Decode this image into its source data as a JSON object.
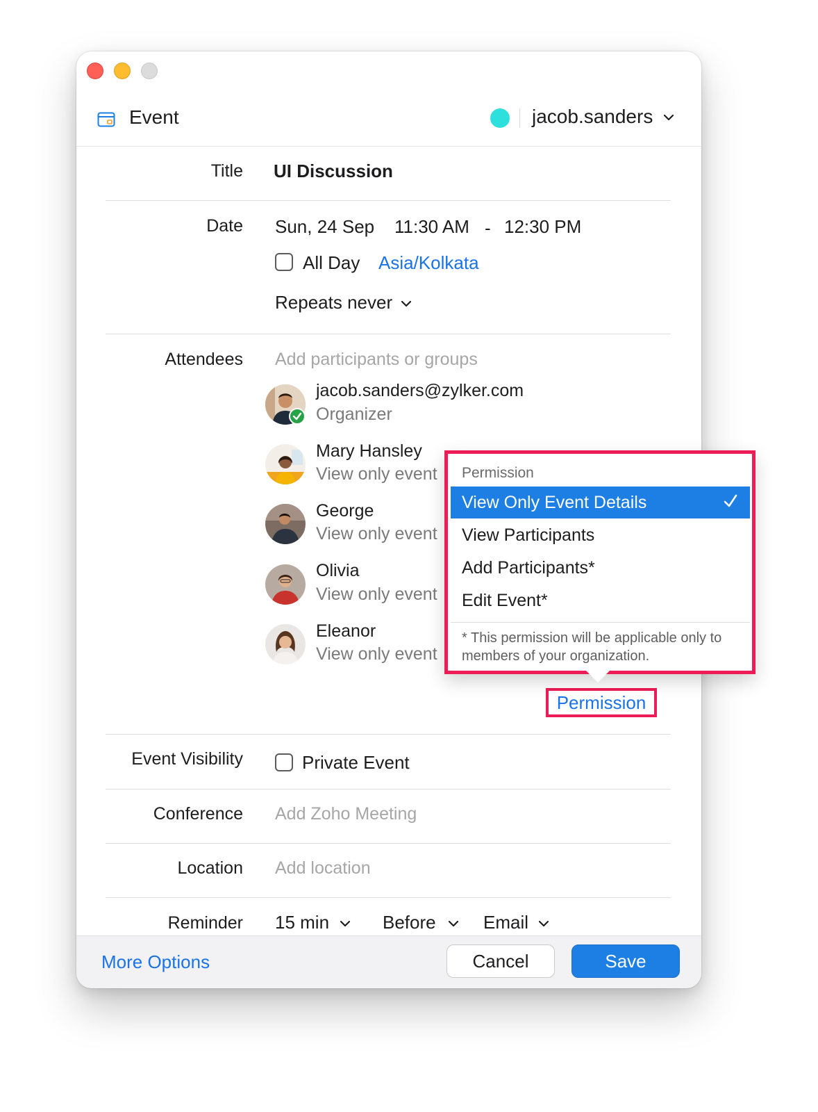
{
  "header": {
    "title": "Event",
    "account": "jacob.sanders",
    "account_color": "#2ee0dd"
  },
  "title_row": {
    "label": "Title",
    "value": "UI Discussion"
  },
  "date_row": {
    "label": "Date",
    "date": "Sun, 24 Sep",
    "start_time": "11:30 AM",
    "separator": "-",
    "end_time": "12:30 PM",
    "all_day_label": "All Day",
    "all_day_checked": false,
    "timezone": "Asia/Kolkata",
    "repeats": "Repeats never"
  },
  "attendees": {
    "label": "Attendees",
    "placeholder": "Add participants or groups",
    "people": [
      {
        "name": "jacob.sanders@zylker.com",
        "sub": "Organizer"
      },
      {
        "name": "Mary Hansley",
        "sub": "View only event"
      },
      {
        "name": "George",
        "sub": "View only event"
      },
      {
        "name": "Olivia",
        "sub": "View only event"
      },
      {
        "name": "Eleanor",
        "sub": "View only event"
      }
    ],
    "permission_link": "Permission"
  },
  "permission_menu": {
    "header": "Permission",
    "options": [
      {
        "label": "View Only Event Details",
        "selected": true
      },
      {
        "label": "View Participants",
        "selected": false
      },
      {
        "label": "Add Participants*",
        "selected": false
      },
      {
        "label": "Edit Event*",
        "selected": false
      }
    ],
    "note": "* This permission will be applicable only to members of your organization."
  },
  "visibility": {
    "label": "Event Visibility",
    "option": "Private Event",
    "checked": false
  },
  "conference": {
    "label": "Conference",
    "placeholder": "Add Zoho Meeting"
  },
  "location": {
    "label": "Location",
    "placeholder": "Add location"
  },
  "reminder": {
    "label": "Reminder",
    "duration": "15 min",
    "when": "Before",
    "method": "Email"
  },
  "footer": {
    "more_options": "More Options",
    "cancel": "Cancel",
    "save": "Save"
  },
  "colors": {
    "accent": "#1d7fe3",
    "link": "#1a73e8",
    "highlight": "#ee1c56"
  }
}
